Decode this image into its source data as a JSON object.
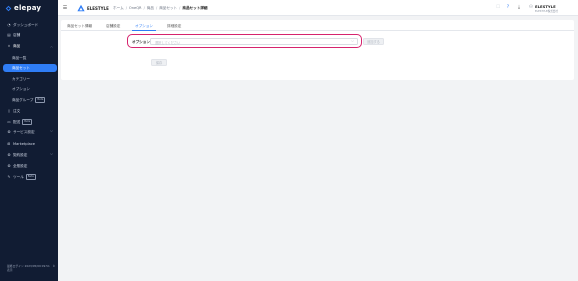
{
  "app": {
    "logo_text": "elepay"
  },
  "sidebar": {
    "items": [
      {
        "label": "ダッシュボード",
        "icon": "dashboard-icon"
      },
      {
        "label": "店舗",
        "icon": "store-icon"
      },
      {
        "label": "商品",
        "icon": "tag-icon"
      },
      {
        "label": "商品一覧"
      },
      {
        "label": "商品セット"
      },
      {
        "label": "カテゴリー"
      },
      {
        "label": "オプション"
      },
      {
        "label": "商品グループ",
        "badge": "Beta"
      },
      {
        "label": "注文",
        "icon": "receipt-icon"
      },
      {
        "label": "配送",
        "icon": "truck-icon",
        "badge": "Beta"
      },
      {
        "label": "サービス設定",
        "icon": "settings-icon"
      },
      {
        "label": "Marketplace",
        "icon": "grid-icon"
      },
      {
        "label": "契約設定",
        "icon": "contract-icon"
      },
      {
        "label": "全般設定",
        "icon": "gear-icon"
      },
      {
        "label": "ツール",
        "icon": "tool-icon",
        "badge": "Beta"
      }
    ],
    "footer_line1": "最終ログイン 2023/05/09 09:51",
    "footer_line2": "表示"
  },
  "topbar": {
    "shop_name": "ELESTYLE",
    "breadcrumbs": [
      "ホーム",
      "OneQR",
      "商品",
      "商品セット",
      "商品セット詳細"
    ],
    "user_name": "ELESTYLE",
    "user_sub": "ELESTYLE株式会社"
  },
  "tabs": [
    "商品セット情報",
    "店舗設定",
    "オプション",
    "詳細設定"
  ],
  "active_tab": "オプション",
  "option_form": {
    "label": "オプション",
    "placeholder": "選択してください",
    "add_button": "追加する",
    "save_button": "保存"
  },
  "colors": {
    "accent": "#2f7df6",
    "sidebar_bg": "#111c33",
    "highlight": "#d6246e"
  }
}
